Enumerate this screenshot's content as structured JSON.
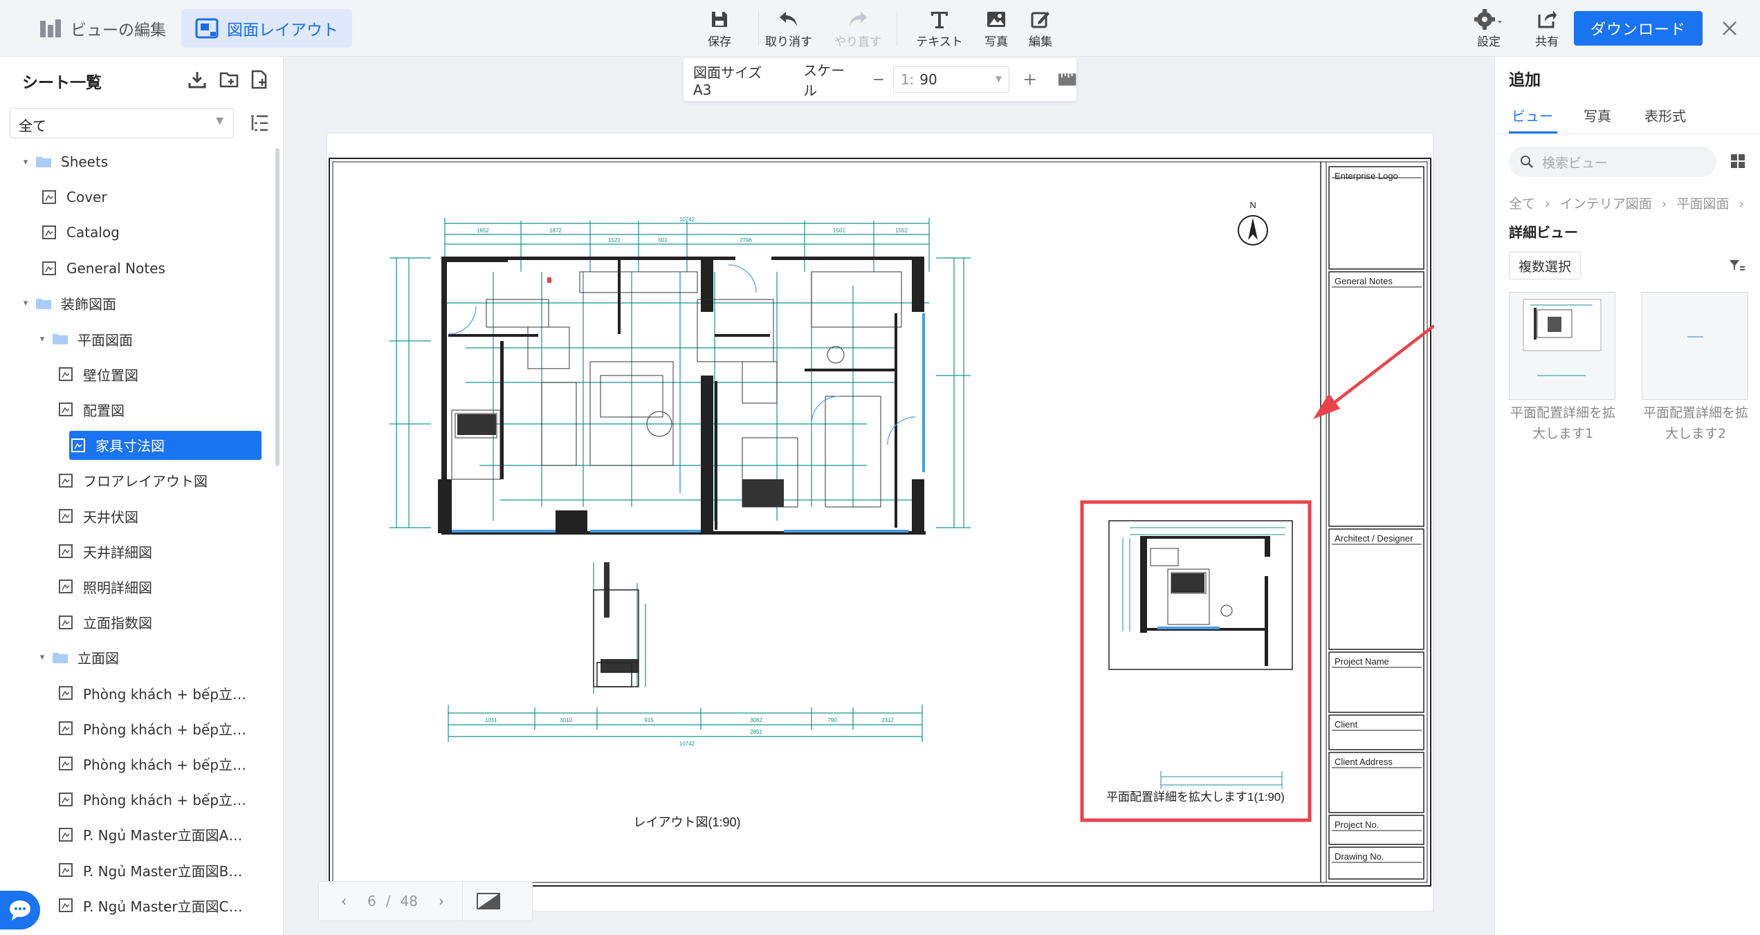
{
  "topbar": {
    "edit_view_label": "ビューの編集",
    "layout_label": "図面レイアウト",
    "tools": {
      "save": "保存",
      "undo": "取り消す",
      "redo": "やり直す",
      "text": "テキスト",
      "photo": "写真",
      "edit": "編集"
    },
    "settings": "設定",
    "share": "共有",
    "download": "ダウンロード"
  },
  "sidebar": {
    "title": "シート一覧",
    "filter_value": "全て",
    "tree": [
      {
        "label": "Sheets",
        "kind": "folder",
        "level": 0
      },
      {
        "label": "Cover",
        "kind": "sheet",
        "level": 1
      },
      {
        "label": "Catalog",
        "kind": "sheet",
        "level": 1
      },
      {
        "label": "General Notes",
        "kind": "sheet",
        "level": 1
      },
      {
        "label": "装飾図面",
        "kind": "folder",
        "level": 0
      },
      {
        "label": "平面図面",
        "kind": "folder",
        "level": 1
      },
      {
        "label": "壁位置図",
        "kind": "sheet",
        "level": 2
      },
      {
        "label": "配置図",
        "kind": "sheet",
        "level": 2
      },
      {
        "label": "家具寸法図",
        "kind": "sheet",
        "level": 2,
        "selected": true
      },
      {
        "label": "フロアレイアウト図",
        "kind": "sheet",
        "level": 2
      },
      {
        "label": "天井伏図",
        "kind": "sheet",
        "level": 2
      },
      {
        "label": "天井詳細図",
        "kind": "sheet",
        "level": 2
      },
      {
        "label": "照明詳細図",
        "kind": "sheet",
        "level": 2
      },
      {
        "label": "立面指数図",
        "kind": "sheet",
        "level": 2
      },
      {
        "label": "立面図",
        "kind": "folder",
        "level": 1
      },
      {
        "label": "Phòng khách + bếp立…",
        "kind": "sheet",
        "level": 2
      },
      {
        "label": "Phòng khách + bếp立…",
        "kind": "sheet",
        "level": 2
      },
      {
        "label": "Phòng khách + bếp立…",
        "kind": "sheet",
        "level": 2
      },
      {
        "label": "Phòng khách + bếp立…",
        "kind": "sheet",
        "level": 2
      },
      {
        "label": "P. Ngủ Master立面図A…",
        "kind": "sheet",
        "level": 2
      },
      {
        "label": "P. Ngủ Master立面図B…",
        "kind": "sheet",
        "level": 2
      },
      {
        "label": "P. Ngủ Master立面図C…",
        "kind": "sheet",
        "level": 2
      }
    ]
  },
  "canvas": {
    "paper_size": "図面サイズ A3",
    "scale_label": "スケール",
    "scale_prefix": "1:",
    "scale_value": "90",
    "main_view_caption": "レイアウト図(1:90)",
    "detail_view_caption": "平面配置詳細を拡大します1(1:90)",
    "north": "N",
    "dims_top": [
      "1652",
      "1872",
      "1521",
      "501",
      "2796",
      "1501",
      "1552",
      "10742"
    ],
    "dims_bottom": [
      "1011",
      "3010",
      "915",
      "3062",
      "2851",
      "790",
      "2312",
      "10742"
    ],
    "title_block": [
      "Enterprise Logo",
      "General Notes",
      "Architect / Designer",
      "Project Name",
      "Client",
      "Client Address",
      "Project No.",
      "Drawing No."
    ],
    "highlight_color": "#e8434b",
    "drawing_color": "#14938a"
  },
  "pager": {
    "current": "6",
    "separator": "/",
    "total": "48"
  },
  "right_panel": {
    "title": "追加",
    "tabs": [
      "ビュー",
      "写真",
      "表形式"
    ],
    "search_placeholder": "検索ビュー",
    "breadcrumb": [
      "全て",
      "インテリア図面",
      "平面図面"
    ],
    "section_title": "詳細ビュー",
    "multi_select": "複数選択",
    "thumbnails": [
      {
        "caption_line1": "平面配置詳細を拡",
        "caption_line2": "大します1"
      },
      {
        "caption_line1": "平面配置詳細を拡",
        "caption_line2": "大します2"
      }
    ]
  },
  "colors": {
    "accent": "#1a73f0",
    "annotation": "#e8434b"
  }
}
